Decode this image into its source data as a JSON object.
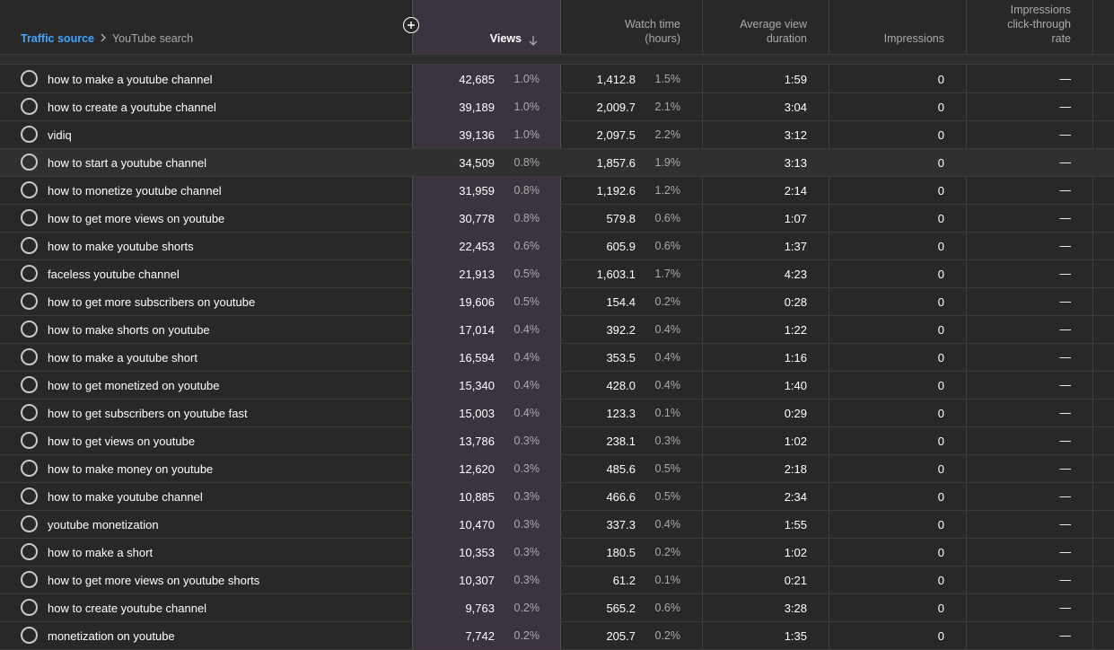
{
  "breadcrumb": {
    "link": "Traffic source",
    "current": "YouTube search"
  },
  "columns": {
    "views": "Views",
    "watch_time": "Watch time",
    "watch_time_unit": "(hours)",
    "avg_view_duration_1": "Average view",
    "avg_view_duration_2": "duration",
    "impressions": "Impressions",
    "ctr_1": "Impressions",
    "ctr_2": "click-through",
    "ctr_3": "rate"
  },
  "rows": [
    {
      "term": "how to make a youtube channel",
      "views": "42,685",
      "views_pct": "1.0%",
      "watch": "1,412.8",
      "watch_pct": "1.5%",
      "avd": "1:59",
      "impr": "0",
      "ctr": "—"
    },
    {
      "term": "how to create a youtube channel",
      "views": "39,189",
      "views_pct": "1.0%",
      "watch": "2,009.7",
      "watch_pct": "2.1%",
      "avd": "3:04",
      "impr": "0",
      "ctr": "—"
    },
    {
      "term": "vidiq",
      "views": "39,136",
      "views_pct": "1.0%",
      "watch": "2,097.5",
      "watch_pct": "2.2%",
      "avd": "3:12",
      "impr": "0",
      "ctr": "—"
    },
    {
      "term": "how to start a youtube channel",
      "views": "34,509",
      "views_pct": "0.8%",
      "watch": "1,857.6",
      "watch_pct": "1.9%",
      "avd": "3:13",
      "impr": "0",
      "ctr": "—"
    },
    {
      "term": "how to monetize youtube channel",
      "views": "31,959",
      "views_pct": "0.8%",
      "watch": "1,192.6",
      "watch_pct": "1.2%",
      "avd": "2:14",
      "impr": "0",
      "ctr": "—"
    },
    {
      "term": "how to get more views on youtube",
      "views": "30,778",
      "views_pct": "0.8%",
      "watch": "579.8",
      "watch_pct": "0.6%",
      "avd": "1:07",
      "impr": "0",
      "ctr": "—"
    },
    {
      "term": "how to make youtube shorts",
      "views": "22,453",
      "views_pct": "0.6%",
      "watch": "605.9",
      "watch_pct": "0.6%",
      "avd": "1:37",
      "impr": "0",
      "ctr": "—"
    },
    {
      "term": "faceless youtube channel",
      "views": "21,913",
      "views_pct": "0.5%",
      "watch": "1,603.1",
      "watch_pct": "1.7%",
      "avd": "4:23",
      "impr": "0",
      "ctr": "—"
    },
    {
      "term": "how to get more subscribers on youtube",
      "views": "19,606",
      "views_pct": "0.5%",
      "watch": "154.4",
      "watch_pct": "0.2%",
      "avd": "0:28",
      "impr": "0",
      "ctr": "—"
    },
    {
      "term": "how to make shorts on youtube",
      "views": "17,014",
      "views_pct": "0.4%",
      "watch": "392.2",
      "watch_pct": "0.4%",
      "avd": "1:22",
      "impr": "0",
      "ctr": "—"
    },
    {
      "term": "how to make a youtube short",
      "views": "16,594",
      "views_pct": "0.4%",
      "watch": "353.5",
      "watch_pct": "0.4%",
      "avd": "1:16",
      "impr": "0",
      "ctr": "—"
    },
    {
      "term": "how to get monetized on youtube",
      "views": "15,340",
      "views_pct": "0.4%",
      "watch": "428.0",
      "watch_pct": "0.4%",
      "avd": "1:40",
      "impr": "0",
      "ctr": "—"
    },
    {
      "term": "how to get subscribers on youtube fast",
      "views": "15,003",
      "views_pct": "0.4%",
      "watch": "123.3",
      "watch_pct": "0.1%",
      "avd": "0:29",
      "impr": "0",
      "ctr": "—"
    },
    {
      "term": "how to get views on youtube",
      "views": "13,786",
      "views_pct": "0.3%",
      "watch": "238.1",
      "watch_pct": "0.3%",
      "avd": "1:02",
      "impr": "0",
      "ctr": "—"
    },
    {
      "term": "how to make money on youtube",
      "views": "12,620",
      "views_pct": "0.3%",
      "watch": "485.6",
      "watch_pct": "0.5%",
      "avd": "2:18",
      "impr": "0",
      "ctr": "—"
    },
    {
      "term": "how to make youtube channel",
      "views": "10,885",
      "views_pct": "0.3%",
      "watch": "466.6",
      "watch_pct": "0.5%",
      "avd": "2:34",
      "impr": "0",
      "ctr": "—"
    },
    {
      "term": "youtube monetization",
      "views": "10,470",
      "views_pct": "0.3%",
      "watch": "337.3",
      "watch_pct": "0.4%",
      "avd": "1:55",
      "impr": "0",
      "ctr": "—"
    },
    {
      "term": "how to make a short",
      "views": "10,353",
      "views_pct": "0.3%",
      "watch": "180.5",
      "watch_pct": "0.2%",
      "avd": "1:02",
      "impr": "0",
      "ctr": "—"
    },
    {
      "term": "how to get more views on youtube shorts",
      "views": "10,307",
      "views_pct": "0.3%",
      "watch": "61.2",
      "watch_pct": "0.1%",
      "avd": "0:21",
      "impr": "0",
      "ctr": "—"
    },
    {
      "term": "how to create youtube channel",
      "views": "9,763",
      "views_pct": "0.2%",
      "watch": "565.2",
      "watch_pct": "0.6%",
      "avd": "3:28",
      "impr": "0",
      "ctr": "—"
    },
    {
      "term": "monetization on youtube",
      "views": "7,742",
      "views_pct": "0.2%",
      "watch": "205.7",
      "watch_pct": "0.2%",
      "avd": "1:35",
      "impr": "0",
      "ctr": "—"
    }
  ]
}
